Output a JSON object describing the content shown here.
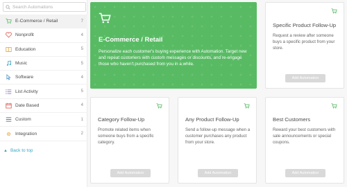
{
  "search": {
    "placeholder": "Search Automations"
  },
  "sidebar": {
    "items": [
      {
        "label": "E-Commerce / Retail",
        "count": "7",
        "icon": "cart-icon",
        "color": "#58bb64"
      },
      {
        "label": "Nonprofit",
        "count": "4",
        "icon": "heart-icon",
        "color": "#e0584f"
      },
      {
        "label": "Education",
        "count": "5",
        "icon": "book-icon",
        "color": "#e8a53a"
      },
      {
        "label": "Music",
        "count": "5",
        "icon": "music-note-icon",
        "color": "#37a7c4"
      },
      {
        "label": "Software",
        "count": "4",
        "icon": "cursor-icon",
        "color": "#4a90c8"
      },
      {
        "label": "List Activity",
        "count": "5",
        "icon": "list-icon",
        "color": "#8a67b5"
      },
      {
        "label": "Date Based",
        "count": "4",
        "icon": "calendar-icon",
        "color": "#e0584f"
      },
      {
        "label": "Custom",
        "count": "1",
        "icon": "menu-icon",
        "color": "#5a6b7b"
      },
      {
        "label": "Integration",
        "count": "2",
        "icon": "gear-icon",
        "color": "#e8a53a"
      }
    ]
  },
  "back_to_top": "Back to top",
  "hero": {
    "title": "E-Commerce / Retail",
    "description": "Personalize each customer's buying experience with Automation. Target new and repeat customers with custom messages or discounts, and re-engage those who haven't purchased from you in a while.",
    "color": "#58bb64"
  },
  "cards": [
    {
      "title": "Specific Product Follow-Up",
      "description": "Request a review after someone buys a specific product from your store.",
      "button": "Add Automation"
    },
    {
      "title": "Category Follow-Up",
      "description": "Promote related items when someone buys from a specific category.",
      "button": "Add Automation"
    },
    {
      "title": "Any Product Follow-Up",
      "description": "Send a follow-up message when a customer purchases any product from your store.",
      "button": "Add Automation"
    },
    {
      "title": "Best Customers",
      "description": "Reward your best customers with sale announcements or special coupons.",
      "button": "Add Automation"
    }
  ]
}
